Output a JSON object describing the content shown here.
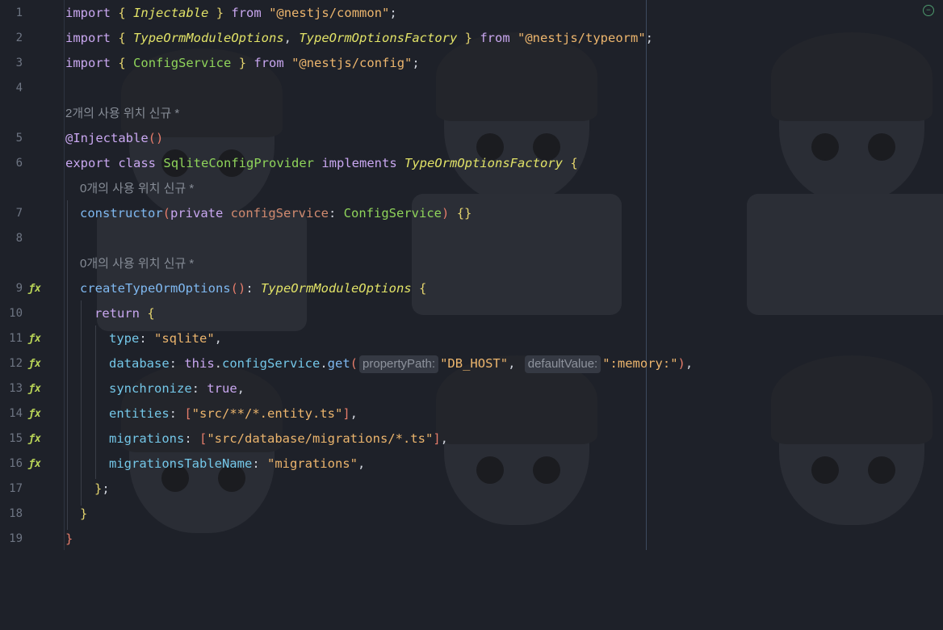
{
  "editor": {
    "fold_icon": "collapse-icon",
    "gutter_icon_glyph": "ƒx",
    "lines": [
      {
        "n": "1",
        "tokens": [
          [
            "kw",
            "import"
          ],
          [
            "plain",
            " "
          ],
          [
            "brace",
            "{"
          ],
          [
            "plain",
            " "
          ],
          [
            "type-i",
            "Injectable"
          ],
          [
            "plain",
            " "
          ],
          [
            "brace",
            "}"
          ],
          [
            "plain",
            " "
          ],
          [
            "kw",
            "from"
          ],
          [
            "plain",
            " "
          ],
          [
            "str",
            "\"@nestjs/common\""
          ],
          [
            "plain",
            ";"
          ]
        ]
      },
      {
        "n": "2",
        "tokens": [
          [
            "kw",
            "import"
          ],
          [
            "plain",
            " "
          ],
          [
            "brace",
            "{"
          ],
          [
            "plain",
            " "
          ],
          [
            "type-i",
            "TypeOrmModuleOptions"
          ],
          [
            "plain",
            ", "
          ],
          [
            "type-i",
            "TypeOrmOptionsFactory"
          ],
          [
            "plain",
            " "
          ],
          [
            "brace",
            "}"
          ],
          [
            "plain",
            " "
          ],
          [
            "kw",
            "from"
          ],
          [
            "plain",
            " "
          ],
          [
            "str",
            "\"@nestjs/typeorm\""
          ],
          [
            "plain",
            ";"
          ]
        ]
      },
      {
        "n": "3",
        "tokens": [
          [
            "kw",
            "import"
          ],
          [
            "plain",
            " "
          ],
          [
            "brace",
            "{"
          ],
          [
            "plain",
            " "
          ],
          [
            "cls-g",
            "ConfigService"
          ],
          [
            "plain",
            " "
          ],
          [
            "brace",
            "}"
          ],
          [
            "plain",
            " "
          ],
          [
            "kw",
            "from"
          ],
          [
            "plain",
            " "
          ],
          [
            "str",
            "\"@nestjs/config\""
          ],
          [
            "plain",
            ";"
          ]
        ]
      },
      {
        "n": "4",
        "tokens": []
      },
      {
        "n": "",
        "hint": "2개의 사용 위치   신규 *"
      },
      {
        "n": "5",
        "tokens": [
          [
            "dec",
            "@Injectable"
          ],
          [
            "paren",
            "()"
          ]
        ]
      },
      {
        "n": "6",
        "tokens": [
          [
            "kw",
            "export"
          ],
          [
            "plain",
            " "
          ],
          [
            "kw",
            "class"
          ],
          [
            "plain",
            " "
          ],
          [
            "cls-g",
            "SqliteConfigProvider"
          ],
          [
            "plain",
            " "
          ],
          [
            "kw",
            "implements"
          ],
          [
            "plain",
            " "
          ],
          [
            "type-i",
            "TypeOrmOptionsFactory"
          ],
          [
            "plain",
            " "
          ],
          [
            "brace",
            "{"
          ]
        ]
      },
      {
        "n": "",
        "hint": "0개의 사용 위치   신규 *",
        "indent": 1
      },
      {
        "n": "7",
        "indent": 1,
        "tokens": [
          [
            "func",
            "constructor"
          ],
          [
            "paren",
            "("
          ],
          [
            "kw",
            "private"
          ],
          [
            "plain",
            " "
          ],
          [
            "param",
            "configService"
          ],
          [
            "plain",
            ": "
          ],
          [
            "cls-g",
            "ConfigService"
          ],
          [
            "paren",
            ")"
          ],
          [
            "plain",
            " "
          ],
          [
            "brace",
            "{}"
          ]
        ]
      },
      {
        "n": "8",
        "tokens": []
      },
      {
        "n": "",
        "hint": "0개의 사용 위치   신규 *",
        "indent": 1
      },
      {
        "n": "9",
        "icon": true,
        "indent": 1,
        "tokens": [
          [
            "func",
            "createTypeOrmOptions"
          ],
          [
            "paren",
            "()"
          ],
          [
            "plain",
            ": "
          ],
          [
            "type-i",
            "TypeOrmModuleOptions"
          ],
          [
            "plain",
            " "
          ],
          [
            "brace",
            "{"
          ]
        ]
      },
      {
        "n": "10",
        "indent": 2,
        "tokens": [
          [
            "kw",
            "return"
          ],
          [
            "plain",
            " "
          ],
          [
            "brace",
            "{"
          ]
        ]
      },
      {
        "n": "11",
        "icon": true,
        "indent": 3,
        "tokens": [
          [
            "prop",
            "type"
          ],
          [
            "plain",
            ": "
          ],
          [
            "str",
            "\"sqlite\""
          ],
          [
            "plain",
            ","
          ]
        ]
      },
      {
        "n": "12",
        "icon": true,
        "indent": 3,
        "tokens": [
          [
            "prop",
            "database"
          ],
          [
            "plain",
            ": "
          ],
          [
            "kw",
            "this"
          ],
          [
            "plain",
            "."
          ],
          [
            "prop",
            "configService"
          ],
          [
            "plain",
            "."
          ],
          [
            "func",
            "get"
          ],
          [
            "paren",
            "("
          ],
          [
            "inlay",
            "propertyPath:"
          ],
          [
            "str",
            "\"DB_HOST\""
          ],
          [
            "plain",
            ", "
          ],
          [
            "inlay",
            "defaultValue:"
          ],
          [
            "str",
            "\":memory:\""
          ],
          [
            "paren",
            ")"
          ],
          [
            "plain",
            ","
          ]
        ]
      },
      {
        "n": "13",
        "icon": true,
        "indent": 3,
        "tokens": [
          [
            "prop",
            "synchronize"
          ],
          [
            "plain",
            ": "
          ],
          [
            "bool",
            "true"
          ],
          [
            "plain",
            ","
          ]
        ]
      },
      {
        "n": "14",
        "icon": true,
        "indent": 3,
        "tokens": [
          [
            "prop",
            "entities"
          ],
          [
            "plain",
            ": "
          ],
          [
            "paren",
            "["
          ],
          [
            "str",
            "\"src/**/*.entity.ts\""
          ],
          [
            "paren",
            "]"
          ],
          [
            "plain",
            ","
          ]
        ]
      },
      {
        "n": "15",
        "icon": true,
        "indent": 3,
        "tokens": [
          [
            "prop",
            "migrations"
          ],
          [
            "plain",
            ": "
          ],
          [
            "paren",
            "["
          ],
          [
            "str",
            "\"src/database/migrations/*.ts\""
          ],
          [
            "paren",
            "]"
          ],
          [
            "plain",
            ","
          ]
        ]
      },
      {
        "n": "16",
        "icon": true,
        "indent": 3,
        "tokens": [
          [
            "prop",
            "migrationsTableName"
          ],
          [
            "plain",
            ": "
          ],
          [
            "str",
            "\"migrations\""
          ],
          [
            "plain",
            ","
          ]
        ]
      },
      {
        "n": "17",
        "indent": 2,
        "tokens": [
          [
            "brace",
            "}"
          ],
          [
            "plain",
            ";"
          ]
        ]
      },
      {
        "n": "18",
        "indent": 1,
        "tokens": [
          [
            "brace",
            "}"
          ]
        ]
      },
      {
        "n": "19",
        "tokens": [
          [
            "paren",
            "}"
          ]
        ]
      }
    ]
  }
}
